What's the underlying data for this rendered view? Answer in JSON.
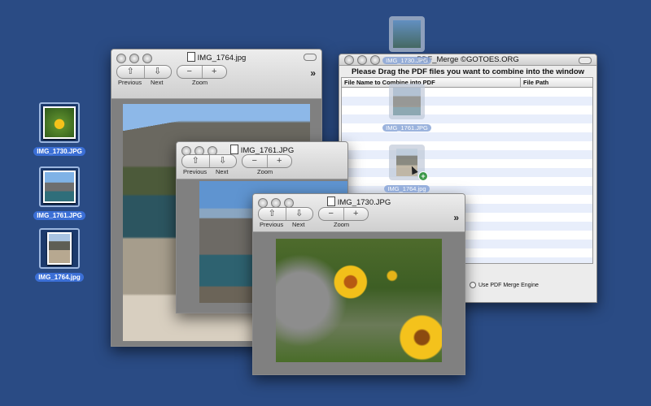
{
  "desktop": {
    "icons": [
      {
        "label": "IMG_1730.JPG"
      },
      {
        "label": "IMG_1761.JPG"
      },
      {
        "label": "IMG_1764.jpg"
      }
    ]
  },
  "viewer": {
    "prev_label": "Previous",
    "next_label": "Next",
    "zoom_label": "Zoom",
    "zoom_out_symbol": "−",
    "zoom_in_symbol": "+",
    "overflow_symbol": "»"
  },
  "windows": {
    "w1764": {
      "title": "IMG_1764.jpg"
    },
    "w1761": {
      "title": "IMG_1761.JPG"
    },
    "w1730": {
      "title": "IMG_1730.JPG"
    }
  },
  "pdf_merge": {
    "title": "PDF_Merge ©GOTOES.ORG",
    "instruction": "Please Drag the PDF files you want to combine into the window",
    "columns": [
      "File Name to Combine into PDF",
      "File Path"
    ],
    "engine_option": "Use PDF Merge Engine"
  },
  "drag": {
    "items": [
      {
        "label": "IMG_1730.JPG"
      },
      {
        "label": "IMG_1761.JPG"
      },
      {
        "label": "IMG_1764.jpg"
      }
    ],
    "badge": "+"
  },
  "colors": {
    "desktop": "#2a4b84",
    "selection": "#3b6fd6"
  }
}
